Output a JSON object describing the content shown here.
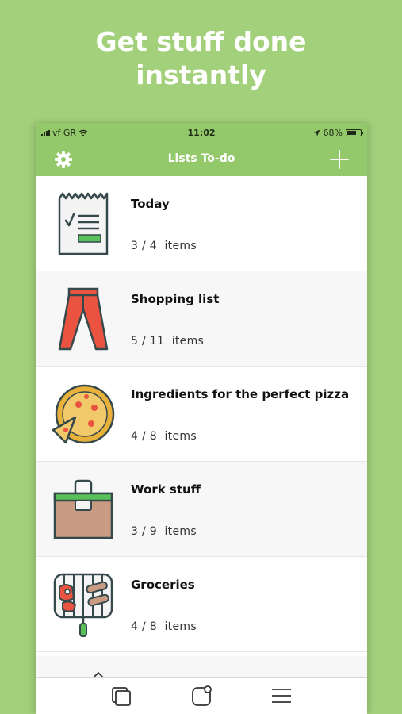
{
  "promo": {
    "line1": "Get stuff done",
    "line2": "instantly"
  },
  "status_bar": {
    "carrier": "vf GR",
    "time": "11:02",
    "battery": "68%"
  },
  "nav": {
    "title": "Lists To-do",
    "settings_icon": "gear-icon",
    "add_icon": "plus-icon"
  },
  "lists": [
    {
      "title": "Today",
      "done": "3",
      "total": "4",
      "unit": "items",
      "icon": "receipt-checklist-icon"
    },
    {
      "title": "Shopping list",
      "done": "5",
      "total": "11",
      "unit": "items",
      "icon": "pants-icon"
    },
    {
      "title": "Ingredients for the perfect pizza",
      "done": "4",
      "total": "8",
      "unit": "items",
      "icon": "pizza-icon"
    },
    {
      "title": "Work stuff",
      "done": "3",
      "total": "9",
      "unit": "items",
      "icon": "toolbox-icon"
    },
    {
      "title": "Groceries",
      "done": "4",
      "total": "8",
      "unit": "items",
      "icon": "grill-icon"
    }
  ],
  "tab_bar": {
    "icons": [
      "pages-icon",
      "notification-icon",
      "menu-icon"
    ]
  },
  "colors": {
    "background": "#a3d17b",
    "header": "#93c96a",
    "accent_green": "#5ac15a",
    "pants_red": "#e9533f",
    "pizza_yellow": "#e8b23a"
  }
}
